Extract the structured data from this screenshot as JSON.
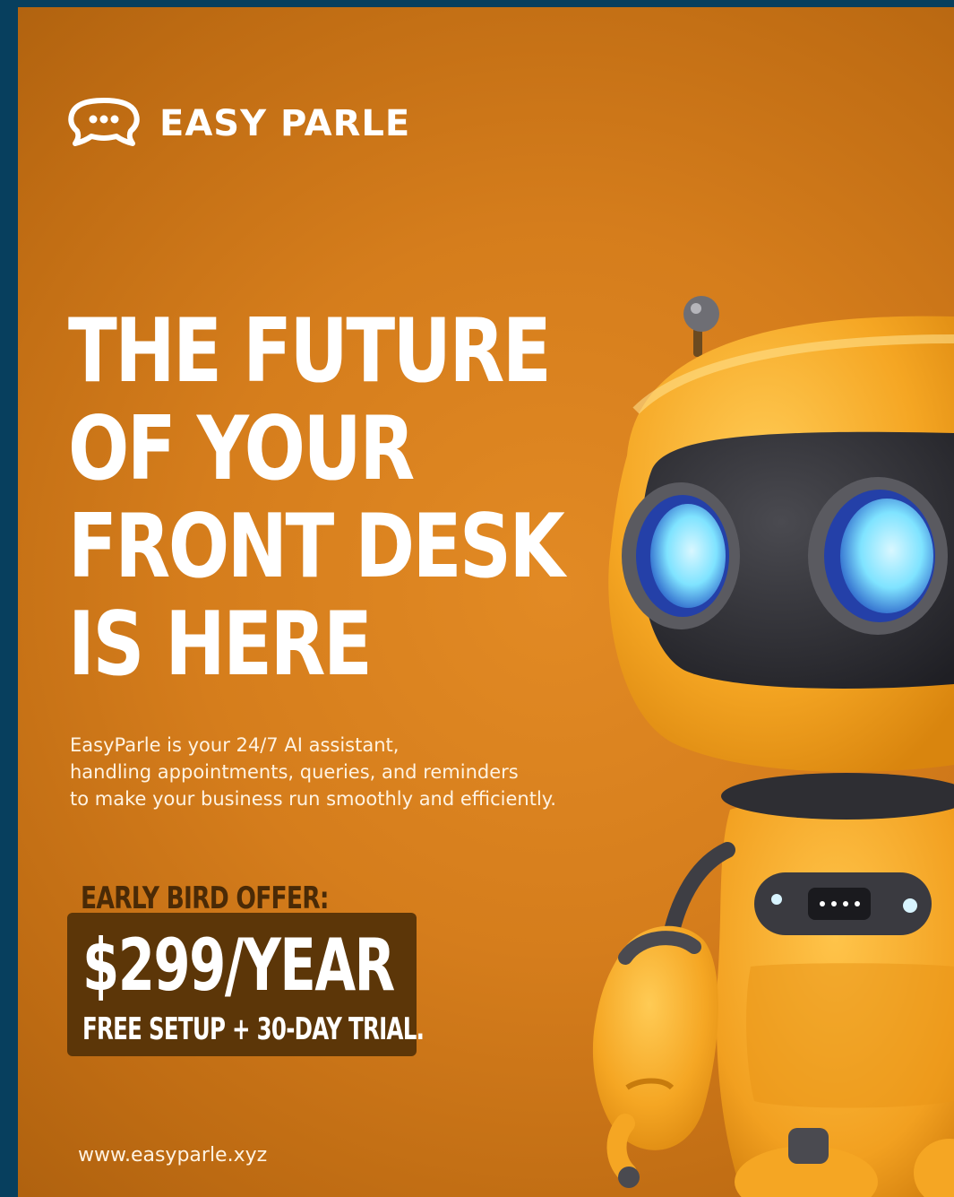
{
  "brand": {
    "name": "EASY PARLE",
    "icon": "chat-bubble-icon"
  },
  "headline": {
    "line1": "THE FUTURE",
    "line2": "OF YOUR",
    "line3": "FRONT DESK",
    "line4": "IS HERE"
  },
  "description": {
    "line1": "EasyParle is your 24/7 AI assistant,",
    "line2": "handling appointments, queries, and reminders",
    "line3": "to make your business run smoothly and efficiently."
  },
  "offer": {
    "label": "EARLY BIRD OFFER:",
    "price": "$299/YEAR",
    "details": "FREE SETUP + 30-DAY TRIAL."
  },
  "website": "www.easyparle.xyz",
  "illustration": "robot-mascot",
  "colors": {
    "frame": "#073f5e",
    "background": "#d57d1c",
    "offer_box": "#5c3608",
    "offer_label": "#4a2a06",
    "robot_body": "#f5a623",
    "robot_visor": "#2e2e33",
    "robot_eye": "#7fe3ff"
  }
}
